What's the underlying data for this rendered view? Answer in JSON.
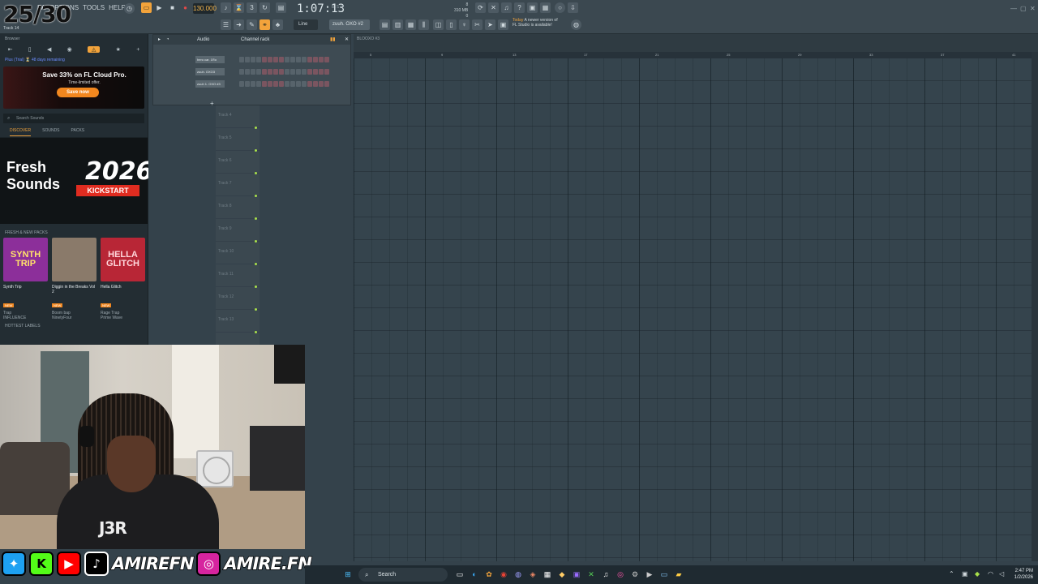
{
  "overlay": {
    "counter": "25/30"
  },
  "menu": [
    "PA",
    "OPTIONS",
    "TOOLS",
    "HELP"
  ],
  "toolbar": {
    "tempo": "130.000",
    "time": "1:07:13",
    "time_unit": "B:S:T",
    "memory": [
      "8",
      "310 MB",
      "0"
    ],
    "snap": "Line",
    "pattern": "zuuh. OXO #2",
    "hint": "Track 14",
    "news_date": "Today",
    "news_text": "A newer version of",
    "news_text2": "FL Studio is available!"
  },
  "browser": {
    "header": "Browser",
    "trial": "Plus (Trial) ⏳ 48 days remaining",
    "promo_title": "Save 33% on FL Cloud Pro.",
    "promo_sub": "Time-limited offer.",
    "promo_button": "Save now",
    "search_placeholder": "Search Sounds",
    "tabs": [
      "DISCOVER",
      "SOUNDS",
      "PACKS"
    ],
    "hero_line1": "Fresh",
    "hero_line2": "Sounds",
    "hero_year": "2026",
    "hero_tag": "KICKSTART",
    "packs_title": "FRESH & NEW PACKS",
    "packs": [
      {
        "art": "SYNTH TRIP",
        "name": "Synth Trip",
        "badge": "NEW",
        "genre": "Trap",
        "label": "INFLUENCE",
        "color": "#b03aa8"
      },
      {
        "art": "",
        "name": "Diggin in the Breaks Vol 2",
        "badge": "NEW",
        "genre": "Boom bap",
        "label": "NinetyFour",
        "color": "#8a7a6a"
      },
      {
        "art": "HELLA GLITCH",
        "name": "Hella Glitch",
        "badge": "NEW",
        "genre": "Rage Trap",
        "label": "Prime Wave",
        "color": "#c02a3a"
      }
    ],
    "hottest": "HOTTEST LABELS"
  },
  "channel_rack": {
    "title": "Channel rack",
    "filter": "Audio",
    "channels": [
      "hero car. 1Ro",
      "zuuh. OXO3",
      "zuuh 1. OXO #3"
    ]
  },
  "playlist": {
    "header": "BLOOXO #3",
    "ruler": [
      "5",
      "9",
      "13",
      "17",
      "21",
      "25",
      "29",
      "33",
      "37",
      "41"
    ],
    "tracks": [
      "Track 4",
      "Track 5",
      "Track 6",
      "Track 7",
      "Track 8",
      "Track 9",
      "Track 10",
      "Track 11",
      "Track 12",
      "Track 13"
    ]
  },
  "webcam": {
    "shirt": "J3R"
  },
  "social": {
    "icons": [
      "twitter-icon",
      "kick-icon",
      "youtube-icon",
      "tiktok-icon"
    ],
    "handle1": "AMIREFN",
    "handle2": "AMIRE.FN"
  },
  "taskbar": {
    "search": "Search",
    "time": "2:47 PM",
    "date": "1/2/2026"
  },
  "colors": {
    "accent": "#f2a33b",
    "bg": "#34424b",
    "led": "#a8e04a"
  }
}
